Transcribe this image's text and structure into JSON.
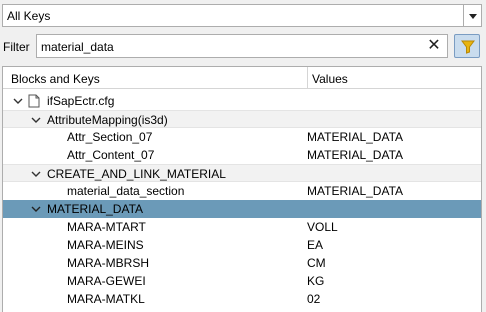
{
  "keys_dropdown": {
    "selected": "All Keys"
  },
  "filter": {
    "label": "Filter",
    "value": "material_data",
    "clear_glyph": "✕"
  },
  "tree": {
    "columns": {
      "keys": "Blocks and Keys",
      "values": "Values"
    },
    "root": {
      "label": "ifSapEctr.cfg"
    },
    "groups": [
      {
        "label": "AttributeMapping(is3d)",
        "items": [
          {
            "key": "Attr_Section_07",
            "value": "MATERIAL_DATA"
          },
          {
            "key": "Attr_Content_07",
            "value": "MATERIAL_DATA"
          }
        ]
      },
      {
        "label": "CREATE_AND_LINK_MATERIAL",
        "items": [
          {
            "key": "material_data_section",
            "value": "MATERIAL_DATA"
          }
        ]
      },
      {
        "label": "MATERIAL_DATA",
        "items": [
          {
            "key": "MARA-MTART",
            "value": "VOLL"
          },
          {
            "key": "MARA-MEINS",
            "value": "EA"
          },
          {
            "key": "MARA-MBRSH",
            "value": "CM"
          },
          {
            "key": "MARA-GEWEI",
            "value": "KG"
          },
          {
            "key": "MARA-MATKL",
            "value": "02"
          }
        ]
      }
    ]
  },
  "colors": {
    "selected_row": "#6b9ab8",
    "funnel": "#e8b410"
  }
}
